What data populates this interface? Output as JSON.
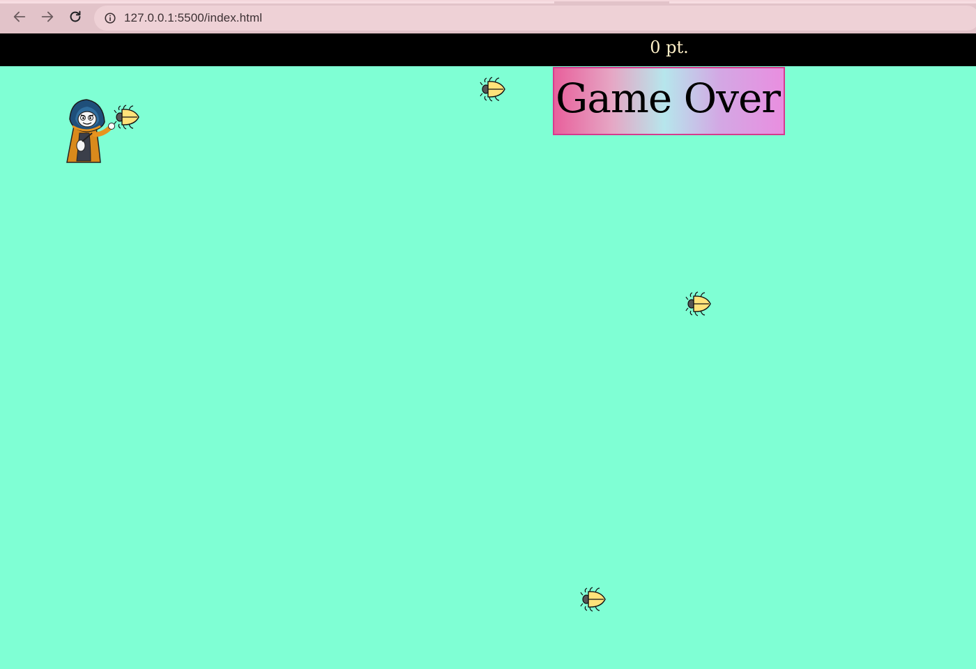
{
  "browser": {
    "url": "127.0.0.1:5500/index.html",
    "icons": [
      "back-arrow-icon",
      "forward-arrow-icon",
      "reload-icon",
      "info-icon"
    ]
  },
  "game": {
    "score_label": "0 pt.",
    "game_over_label": "Game Over",
    "background_color": "#7fffd4",
    "score_bar_color": "#000000",
    "bug_count": 4,
    "player_icon": "wizard-icon",
    "enemy_icon": "beetle-icon"
  }
}
